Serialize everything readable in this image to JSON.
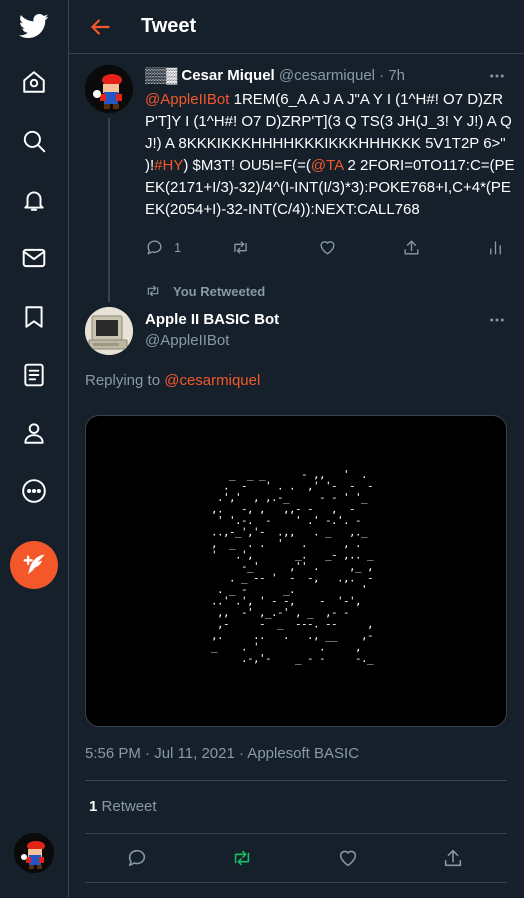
{
  "header": {
    "title": "Tweet"
  },
  "sidebar": {
    "items": [
      {
        "name": "twitter-logo-icon"
      },
      {
        "name": "home-icon"
      },
      {
        "name": "explore-icon"
      },
      {
        "name": "notifications-icon"
      },
      {
        "name": "messages-icon"
      },
      {
        "name": "bookmarks-icon"
      },
      {
        "name": "lists-icon"
      },
      {
        "name": "profile-icon"
      },
      {
        "name": "more-icon"
      }
    ],
    "compose_icon": "compose-tweet-icon"
  },
  "tweet1": {
    "display_name": "▒▒▓ Cesar Miquel",
    "handle": "@cesarmiquel",
    "separator": "·",
    "time": "7h",
    "text_segments": [
      {
        "text": "@AppleIIBot",
        "link": true
      },
      {
        "text": " 1REM(6_A A J A J\"A Y I (1^H#! O7 D)ZRP'T]Y I (1^H#! O7 D)ZRP'T](3 Q TS(3 JH(J_3! Y J!) A Q J!) A 8KKKIKKKHHHHKKKIKKKHHHKKK 5V1T2P 6>\" )!",
        "link": false
      },
      {
        "text": "#HY",
        "link": true
      },
      {
        "text": ") $M3T! OU5I=F(=(",
        "link": false
      },
      {
        "text": "@TA",
        "link": true
      },
      {
        "text": " 2 2FORI=0TO117:C=(PEEK(2171+I/3)-32)/4^(I-INT(I/3)*3):POKE768+I,C+4*(PEEK(2054+I)-32-INT(C/4)):NEXT:CALL768",
        "link": false
      }
    ],
    "reply_count": "1"
  },
  "retweet_context": {
    "label": "You Retweeted"
  },
  "tweet2": {
    "display_name": "Apple II BASIC Bot",
    "handle": "@AppleIIBot",
    "replying_prefix": "Replying to",
    "replying_to": "@cesarmiquel",
    "timestamp": "5:56 PM · Jul 11, 2021 · Applesoft BASIC",
    "retweet_count": "1",
    "retweet_label": "Retweet"
  },
  "colors": {
    "background": "#15202b",
    "accent": "#f4582a",
    "muted": "#8899a6",
    "border": "#38444d",
    "retweet_green": "#17bf63"
  }
}
